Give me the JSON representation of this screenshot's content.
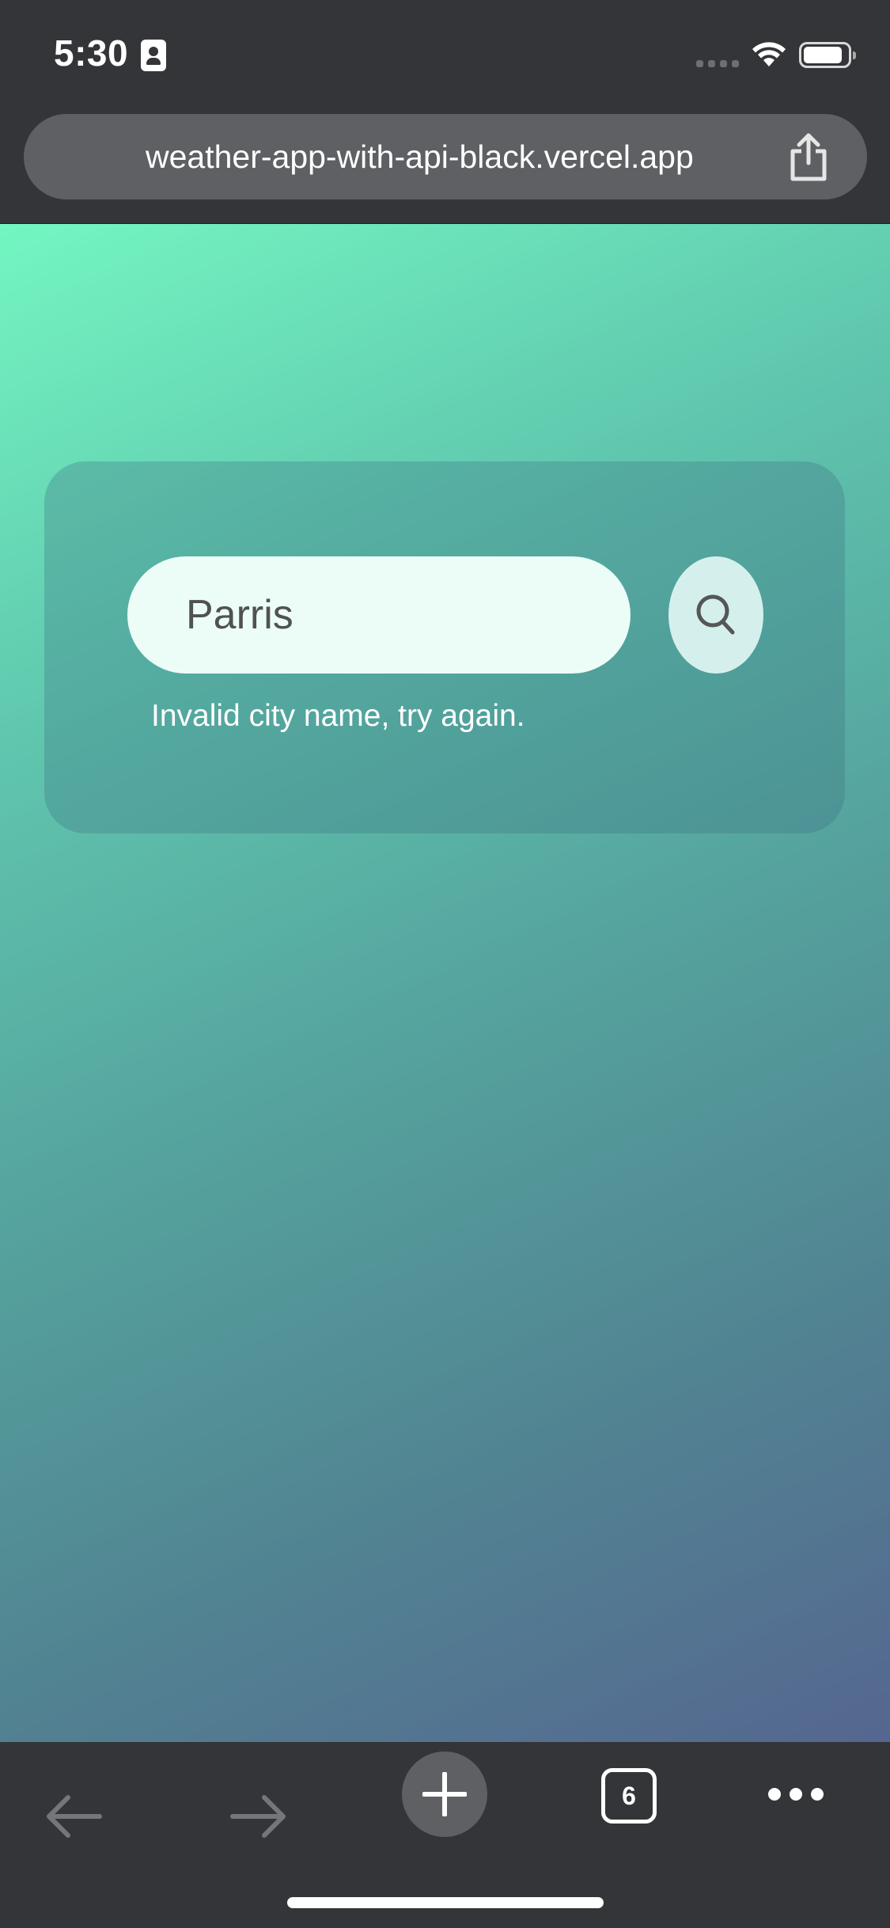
{
  "status_bar": {
    "time": "5:30"
  },
  "address_bar": {
    "url": "weather-app-with-api-black.vercel.app"
  },
  "weather_card": {
    "search_value": "Parris",
    "error_message": "Invalid city name, try again."
  },
  "bottom_toolbar": {
    "tab_count": "6"
  },
  "icons": {
    "status": [
      "id-card-icon",
      "cellular-signal-icon",
      "wifi-icon",
      "battery-icon"
    ],
    "address_bar": [
      "share-icon"
    ],
    "card": [
      "search-icon"
    ],
    "toolbar": [
      "back-arrow-icon",
      "forward-arrow-icon",
      "plus-icon",
      "tabs-icon",
      "more-icon"
    ]
  },
  "colors": {
    "browser_chrome": "#343538",
    "address_bar": "#5f6064",
    "gradient_start": "#73f6c1",
    "gradient_end": "#556690",
    "input_background": "#ecfdf8",
    "search_button": "#d5f0ec"
  }
}
